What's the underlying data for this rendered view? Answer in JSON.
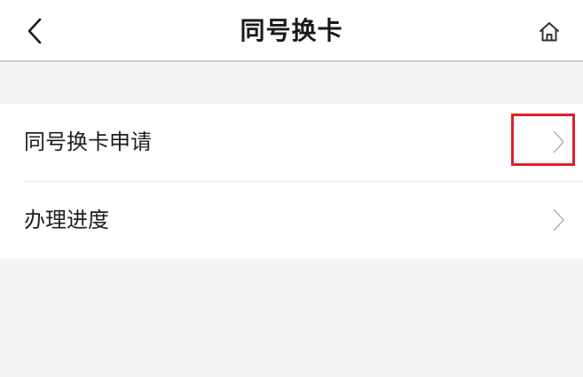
{
  "header": {
    "title": "同号换卡",
    "back_icon": "chevron-left-icon",
    "home_icon": "home-icon"
  },
  "list": {
    "items": [
      {
        "label": "同号换卡申请",
        "icon": "chevron-right-icon"
      },
      {
        "label": "办理进度",
        "icon": "chevron-right-icon"
      }
    ]
  },
  "colors": {
    "highlight": "#e0202b",
    "background": "#f5f5f5",
    "chevron": "#b5b5b5"
  }
}
